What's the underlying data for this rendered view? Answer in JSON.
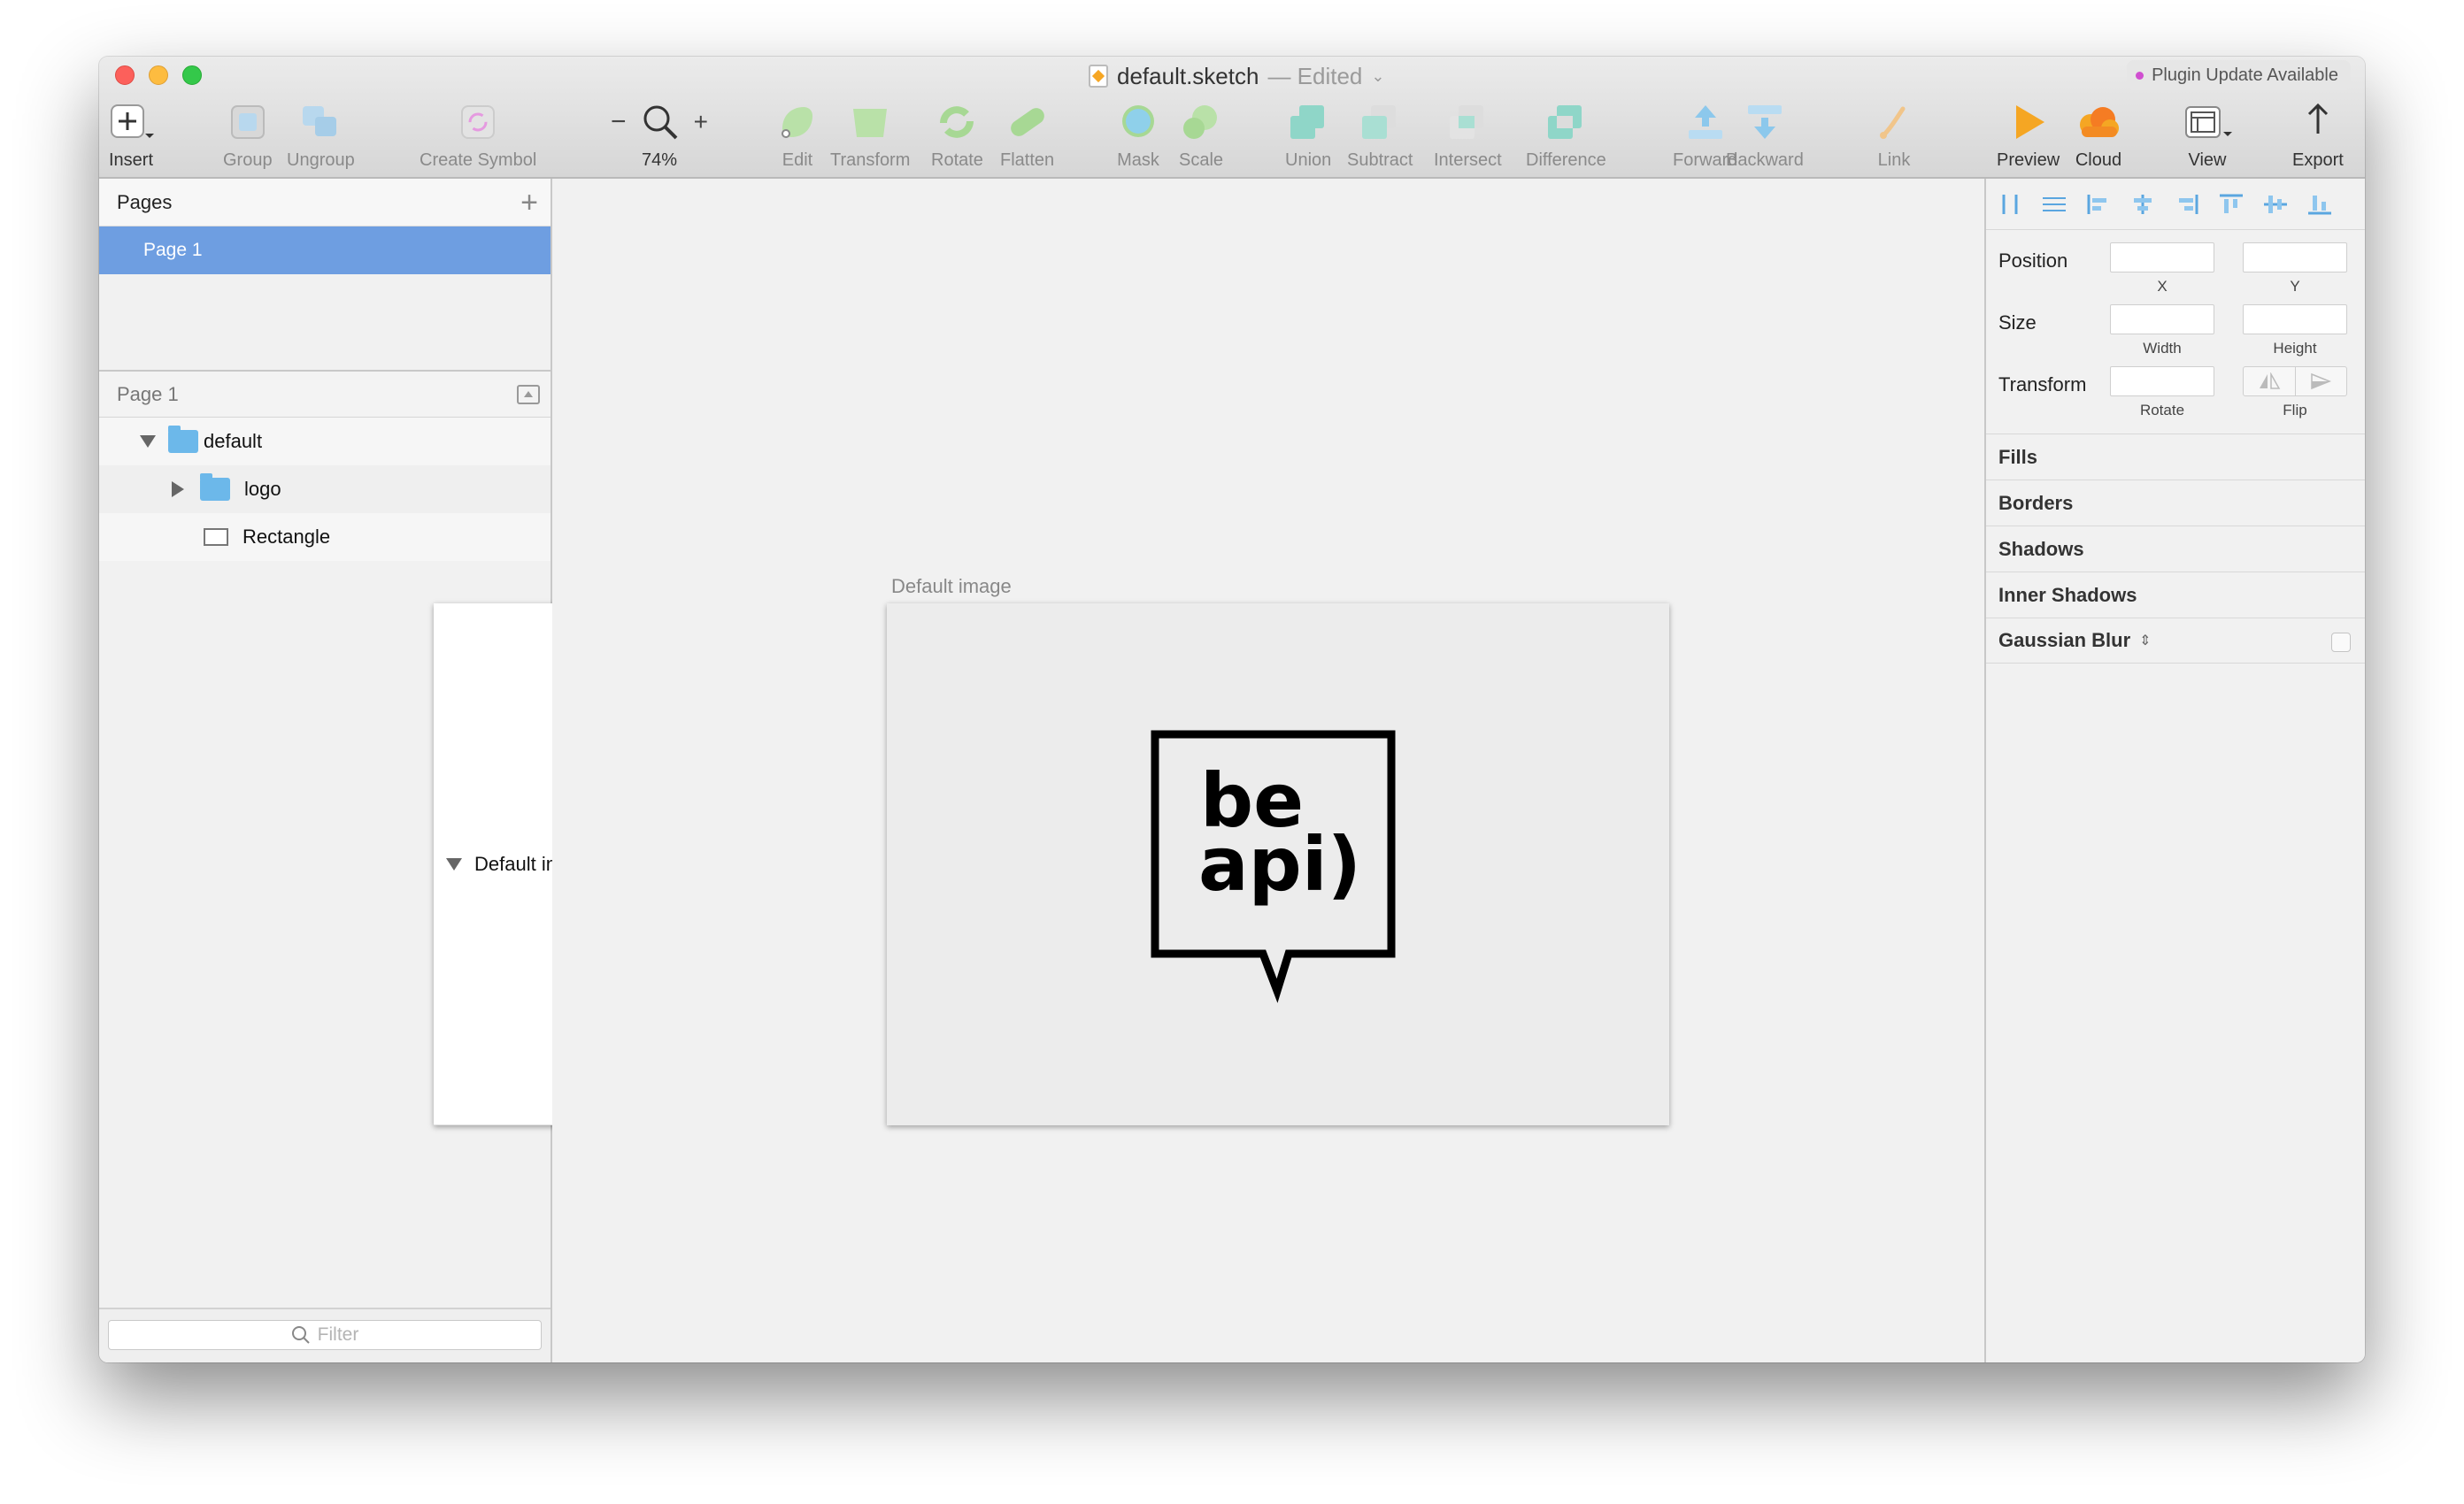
{
  "window": {
    "doc_name": "default.sketch",
    "doc_status": "— Edited",
    "plugin_badge": "Plugin Update Available"
  },
  "toolbar": {
    "insert": "Insert",
    "group": "Group",
    "ungroup": "Ungroup",
    "create_symbol": "Create Symbol",
    "zoom_minus": "−",
    "zoom_plus": "+",
    "zoom_level": "74%",
    "edit": "Edit",
    "transform": "Transform",
    "rotate": "Rotate",
    "flatten": "Flatten",
    "mask": "Mask",
    "scale": "Scale",
    "union": "Union",
    "subtract": "Subtract",
    "intersect": "Intersect",
    "difference": "Difference",
    "forward": "Forward",
    "backward": "Backward",
    "link": "Link",
    "preview": "Preview",
    "cloud": "Cloud",
    "view": "View",
    "export": "Export"
  },
  "pages_panel": {
    "title": "Pages",
    "pages": [
      "Page 1"
    ]
  },
  "layers_panel": {
    "current_page": "Page 1",
    "layers": [
      {
        "name": "Default image",
        "kind": "artboard"
      },
      {
        "name": "default",
        "kind": "group"
      },
      {
        "name": "logo",
        "kind": "group"
      },
      {
        "name": "Rectangle",
        "kind": "rectangle"
      }
    ],
    "filter_placeholder": "Filter"
  },
  "canvas": {
    "artboard_label": "Default image",
    "logo_line1": "be",
    "logo_line2": "api)"
  },
  "inspector": {
    "position": "Position",
    "size": "Size",
    "transform": "Transform",
    "x": "X",
    "y": "Y",
    "width": "Width",
    "height": "Height",
    "rotate": "Rotate",
    "flip": "Flip",
    "sections": [
      "Fills",
      "Borders",
      "Shadows",
      "Inner Shadows",
      "Gaussian Blur"
    ]
  },
  "colors": {
    "selection": "#6e9ee1",
    "folder": "#6cb8ea",
    "accent_orange": "#f6a623"
  }
}
